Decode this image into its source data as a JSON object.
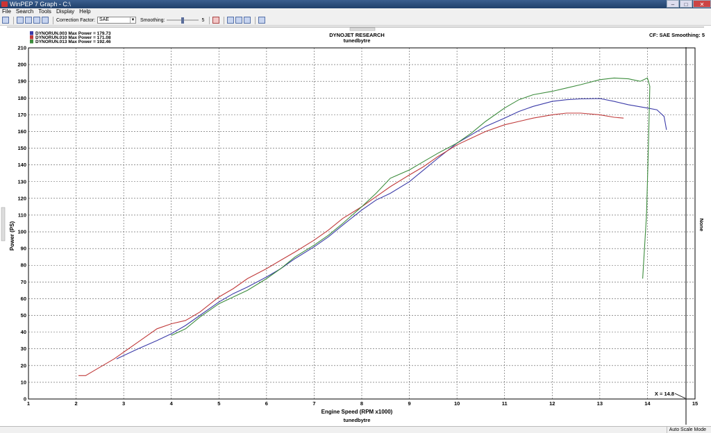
{
  "window": {
    "title": "WinPEP 7    Graph - C:\\",
    "buttons": {
      "minimize": "–",
      "maximize": "□",
      "close": "✕"
    }
  },
  "menu": [
    "File",
    "Search",
    "Tools",
    "Display",
    "Help"
  ],
  "toolbar": {
    "correction_label": "Correction Factor:",
    "correction_value": "SAE",
    "smoothing_label": "Smoothing:",
    "smoothing_value": "5",
    "smoothing_level": 5,
    "smoothing_max": 10
  },
  "graph": {
    "header_title": "DYNOJET RESEARCH",
    "header_subtitle": "tunedbytre",
    "cf_info": "CF: SAE  Smoothing: 5",
    "right_axis_label": "None",
    "cursor_readout": "X = 14.8",
    "footer_label": "tunedbytre"
  },
  "chart_data": {
    "type": "line",
    "xlabel": "Engine Speed (RPM x1000)",
    "ylabel": "Power (PS)",
    "xlim": [
      1,
      15
    ],
    "ylim": [
      0,
      210
    ],
    "xticks": [
      1,
      2,
      3,
      4,
      5,
      6,
      7,
      8,
      9,
      10,
      11,
      12,
      13,
      14,
      15
    ],
    "yticks": [
      0,
      10,
      20,
      30,
      40,
      50,
      60,
      70,
      80,
      90,
      100,
      110,
      120,
      130,
      140,
      150,
      160,
      170,
      180,
      190,
      200,
      210
    ],
    "grid": true,
    "legend_position": "top-left",
    "series": [
      {
        "name": "DYNORUN.003",
        "legend": "DYNORUN.003 Max Power = 179.73",
        "color": "#3a3aa8",
        "points": [
          [
            2.85,
            24
          ],
          [
            3,
            26
          ],
          [
            3.3,
            30
          ],
          [
            3.7,
            35
          ],
          [
            4,
            39
          ],
          [
            4.3,
            44
          ],
          [
            4.6,
            50
          ],
          [
            5,
            58
          ],
          [
            5.3,
            63
          ],
          [
            5.6,
            67
          ],
          [
            6,
            73
          ],
          [
            6.3,
            78
          ],
          [
            6.6,
            84
          ],
          [
            7,
            91
          ],
          [
            7.3,
            97
          ],
          [
            7.6,
            104
          ],
          [
            8,
            113
          ],
          [
            8.3,
            119
          ],
          [
            8.6,
            123
          ],
          [
            9,
            130
          ],
          [
            9.3,
            137
          ],
          [
            9.6,
            144
          ],
          [
            10,
            153
          ],
          [
            10.3,
            158
          ],
          [
            10.6,
            163
          ],
          [
            11,
            168
          ],
          [
            11.3,
            172
          ],
          [
            11.6,
            175
          ],
          [
            12,
            178
          ],
          [
            12.3,
            179
          ],
          [
            12.6,
            179.5
          ],
          [
            13,
            179.7
          ],
          [
            13.3,
            178
          ],
          [
            13.6,
            176
          ],
          [
            14,
            174
          ],
          [
            14.2,
            173
          ],
          [
            14.35,
            169
          ],
          [
            14.4,
            161
          ]
        ]
      },
      {
        "name": "DYNORUN.010",
        "legend": "DYNORUN.010 Max Power = 171.08",
        "color": "#c03a3a",
        "points": [
          [
            2.05,
            14
          ],
          [
            2.2,
            14
          ],
          [
            2.5,
            19
          ],
          [
            2.8,
            24
          ],
          [
            3,
            28
          ],
          [
            3.3,
            34
          ],
          [
            3.7,
            42
          ],
          [
            4,
            45
          ],
          [
            4.3,
            47
          ],
          [
            4.6,
            52
          ],
          [
            5,
            61
          ],
          [
            5.3,
            66
          ],
          [
            5.6,
            72
          ],
          [
            6,
            78
          ],
          [
            6.3,
            83
          ],
          [
            6.6,
            88
          ],
          [
            7,
            95
          ],
          [
            7.3,
            101
          ],
          [
            7.6,
            108
          ],
          [
            8,
            115
          ],
          [
            8.3,
            121
          ],
          [
            8.6,
            127
          ],
          [
            9,
            134
          ],
          [
            9.3,
            139
          ],
          [
            9.6,
            145
          ],
          [
            10,
            152
          ],
          [
            10.3,
            156
          ],
          [
            10.6,
            160
          ],
          [
            11,
            164
          ],
          [
            11.3,
            166
          ],
          [
            11.6,
            168
          ],
          [
            12,
            170
          ],
          [
            12.3,
            171
          ],
          [
            12.6,
            171
          ],
          [
            13,
            170
          ],
          [
            13.3,
            168.5
          ],
          [
            13.5,
            168
          ]
        ]
      },
      {
        "name": "DYNORUN.013",
        "legend": "DYNORUN.013 Max Power = 192.46",
        "color": "#3c8c3c",
        "points": [
          [
            4,
            38
          ],
          [
            4.3,
            42
          ],
          [
            4.6,
            49
          ],
          [
            5,
            57
          ],
          [
            5.3,
            61
          ],
          [
            5.6,
            65
          ],
          [
            6,
            72
          ],
          [
            6.3,
            78
          ],
          [
            6.6,
            85
          ],
          [
            7,
            92
          ],
          [
            7.3,
            98
          ],
          [
            7.6,
            105
          ],
          [
            8,
            115
          ],
          [
            8.3,
            123
          ],
          [
            8.6,
            132
          ],
          [
            9,
            137
          ],
          [
            9.3,
            142
          ],
          [
            9.6,
            147
          ],
          [
            10,
            153
          ],
          [
            10.3,
            159
          ],
          [
            10.6,
            166
          ],
          [
            11,
            174
          ],
          [
            11.3,
            179
          ],
          [
            11.6,
            182
          ],
          [
            12,
            184
          ],
          [
            12.3,
            186
          ],
          [
            12.6,
            188
          ],
          [
            13,
            191
          ],
          [
            13.3,
            192
          ],
          [
            13.6,
            191.5
          ],
          [
            13.85,
            190
          ],
          [
            14,
            192
          ],
          [
            14.05,
            187
          ],
          [
            14.02,
            150
          ],
          [
            13.98,
            110
          ],
          [
            13.9,
            72
          ]
        ]
      }
    ]
  }
}
